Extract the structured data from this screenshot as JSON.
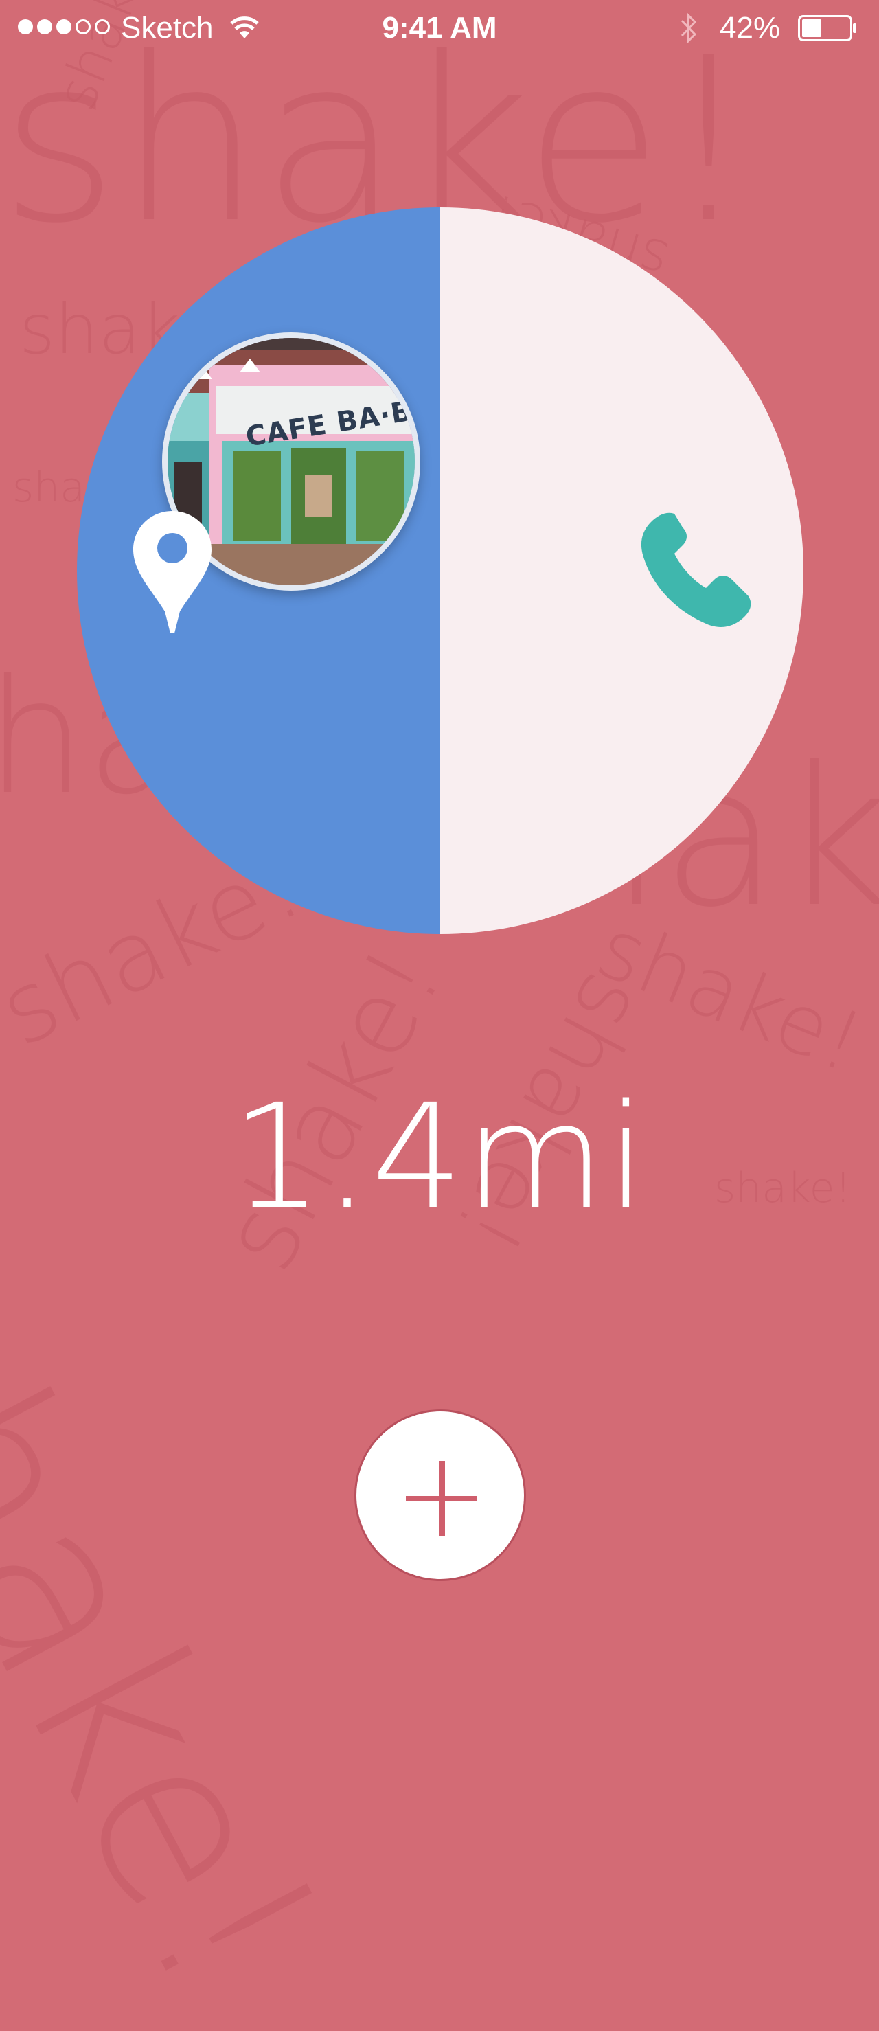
{
  "status_bar": {
    "signal_dots": [
      true,
      true,
      true,
      false,
      false
    ],
    "carrier": "Sketch",
    "time": "9:41 AM",
    "battery_percent": "42%",
    "battery_level": 0.42
  },
  "background": {
    "watermark_text": "shake!",
    "color": "#d36b75"
  },
  "dial": {
    "left_color": "#5b8fd9",
    "right_color": "#f9eef0",
    "photo_sign": "CAFE BA·BA·REE",
    "left_icon": "map-pin-icon",
    "right_icon": "phone-icon",
    "phone_color": "#3fb7ad"
  },
  "distance": {
    "value": "1.4mi"
  },
  "add_button": {
    "icon": "plus-icon",
    "color": "#cf5e6c"
  }
}
